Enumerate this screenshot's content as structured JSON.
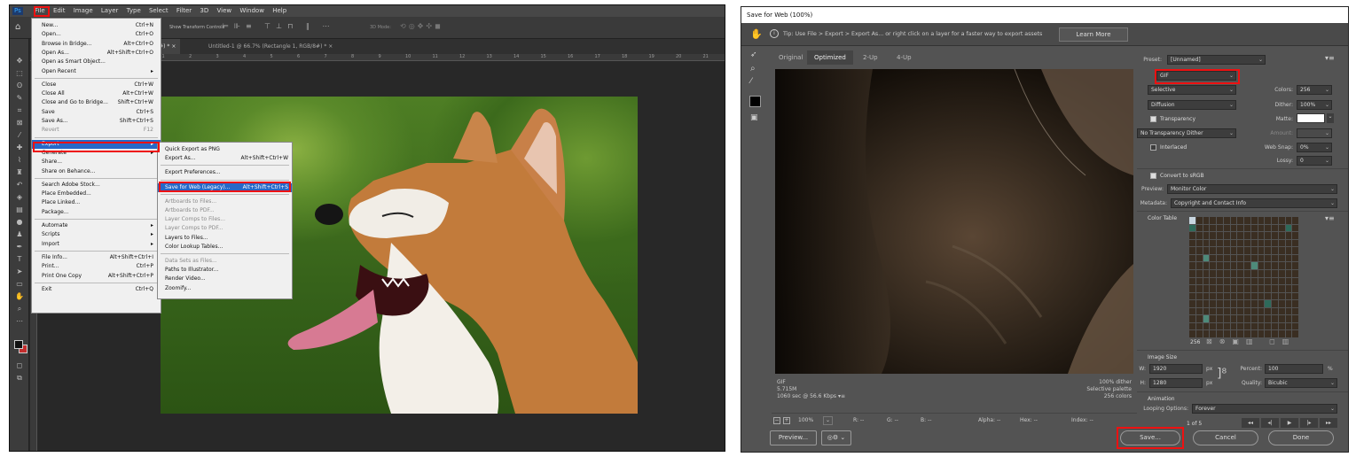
{
  "left": {
    "menubar": [
      "Ps",
      "File",
      "Edit",
      "Image",
      "Layer",
      "Type",
      "Select",
      "Filter",
      "3D",
      "View",
      "Window",
      "Help"
    ],
    "options": {
      "transform": "Show Transform Controls",
      "mode3d": "3D Mode:"
    },
    "tabs": [
      "(8#) * ×",
      "Untitled-1 @ 66.7% (Rectangle 1, RGB/8#) * ×"
    ],
    "ruler_ticks": [
      "0",
      "1",
      "2",
      "3",
      "4",
      "5",
      "6",
      "7",
      "8",
      "9",
      "10",
      "11",
      "12",
      "13",
      "14",
      "15",
      "16",
      "17",
      "18",
      "19",
      "20",
      "21",
      "22",
      "23",
      "24",
      "25"
    ],
    "file_menu": [
      {
        "l": "New...",
        "r": "Ctrl+N"
      },
      {
        "l": "Open...",
        "r": "Ctrl+O"
      },
      {
        "l": "Browse in Bridge...",
        "r": "Alt+Ctrl+O"
      },
      {
        "l": "Open As...",
        "r": "Alt+Shift+Ctrl+O"
      },
      {
        "l": "Open as Smart Object...",
        "r": ""
      },
      {
        "l": "Open Recent",
        "r": "▸"
      },
      {
        "l": "Close",
        "r": "Ctrl+W"
      },
      {
        "l": "Close All",
        "r": "Alt+Ctrl+W"
      },
      {
        "l": "Close and Go to Bridge...",
        "r": "Shift+Ctrl+W"
      },
      {
        "l": "Save",
        "r": "Ctrl+S"
      },
      {
        "l": "Save As...",
        "r": "Shift+Ctrl+S"
      },
      {
        "l": "Revert",
        "r": "F12"
      },
      {
        "l": "Export",
        "r": "▸"
      },
      {
        "l": "Generate",
        "r": "▸"
      },
      {
        "l": "Share...",
        "r": ""
      },
      {
        "l": "Share on Behance...",
        "r": ""
      },
      {
        "l": "Search Adobe Stock...",
        "r": ""
      },
      {
        "l": "Place Embedded...",
        "r": ""
      },
      {
        "l": "Place Linked...",
        "r": ""
      },
      {
        "l": "Package...",
        "r": ""
      },
      {
        "l": "Automate",
        "r": "▸"
      },
      {
        "l": "Scripts",
        "r": "▸"
      },
      {
        "l": "Import",
        "r": "▸"
      },
      {
        "l": "File Info...",
        "r": "Alt+Shift+Ctrl+I"
      },
      {
        "l": "Print...",
        "r": "Ctrl+P"
      },
      {
        "l": "Print One Copy",
        "r": "Alt+Shift+Ctrl+P"
      },
      {
        "l": "Exit",
        "r": "Ctrl+Q"
      }
    ],
    "export_menu": [
      {
        "l": "Quick Export as PNG",
        "r": ""
      },
      {
        "l": "Export As...",
        "r": "Alt+Shift+Ctrl+W"
      },
      {
        "l": "Export Preferences...",
        "r": ""
      },
      {
        "l": "Save for Web (Legacy)...",
        "r": "Alt+Shift+Ctrl+S"
      },
      {
        "l": "Artboards to Files...",
        "r": ""
      },
      {
        "l": "Artboards to PDF...",
        "r": ""
      },
      {
        "l": "Layer Comps to Files...",
        "r": ""
      },
      {
        "l": "Layer Comps to PDF...",
        "r": ""
      },
      {
        "l": "Layers to Files...",
        "r": ""
      },
      {
        "l": "Color Lookup Tables...",
        "r": ""
      },
      {
        "l": "Data Sets as Files...",
        "r": ""
      },
      {
        "l": "Paths to Illustrator...",
        "r": ""
      },
      {
        "l": "Render Video...",
        "r": ""
      },
      {
        "l": "Zoomify...",
        "r": ""
      }
    ]
  },
  "right": {
    "title": "Save for Web (100%)",
    "tip": "Tip: Use File > Export > Export As...  or right click on a layer for a faster way to export assets",
    "learn_more": "Learn More",
    "view_tabs": [
      "Original",
      "Optimized",
      "2-Up",
      "4-Up"
    ],
    "preset_label": "Preset:",
    "preset_value": "[Unnamed]",
    "format": "GIF",
    "reduction": "Selective",
    "colors_label": "Colors:",
    "colors_value": "256",
    "dither_algo": "Diffusion",
    "dither_label": "Dither:",
    "dither_value": "100%",
    "transparency_label": "Transparency",
    "matte_label": "Matte:",
    "trans_dither": "No Transparency Dither",
    "amount_label": "Amount:",
    "interlaced_label": "Interlaced",
    "websnap_label": "Web Snap:",
    "websnap_value": "0%",
    "lossy_label": "Lossy:",
    "lossy_value": "0",
    "convert_srgb": "Convert to sRGB",
    "preview_label": "Preview:",
    "preview_value": "Monitor Color",
    "metadata_label": "Metadata:",
    "metadata_value": "Copyright and Contact Info",
    "color_table_label": "Color Table",
    "color_count": "256",
    "image_size_label": "Image Size",
    "w_label": "W:",
    "w_value": "1920",
    "h_label": "H:",
    "h_value": "1280",
    "px": "px",
    "percent_label": "Percent:",
    "percent_value": "100",
    "pct_sign": "%",
    "quality_label": "Quality:",
    "quality_value": "Bicubic",
    "animation_label": "Animation",
    "looping_label": "Looping Options:",
    "looping_value": "Forever",
    "frame": "1 of 5",
    "info_left": [
      "GIF",
      "5.715M",
      "1060 sec @ 56.6 Kbps  ▾≡"
    ],
    "info_right": [
      "100% dither",
      "Selective palette",
      "256 colors"
    ],
    "zoom": "100%",
    "status": [
      "R: --",
      "G: --",
      "B: --",
      "Alpha: --",
      "Hex: --",
      "Index: --"
    ],
    "preview_btn": "Preview...",
    "save_btn": "Save...",
    "cancel_btn": "Cancel",
    "done_btn": "Done"
  }
}
